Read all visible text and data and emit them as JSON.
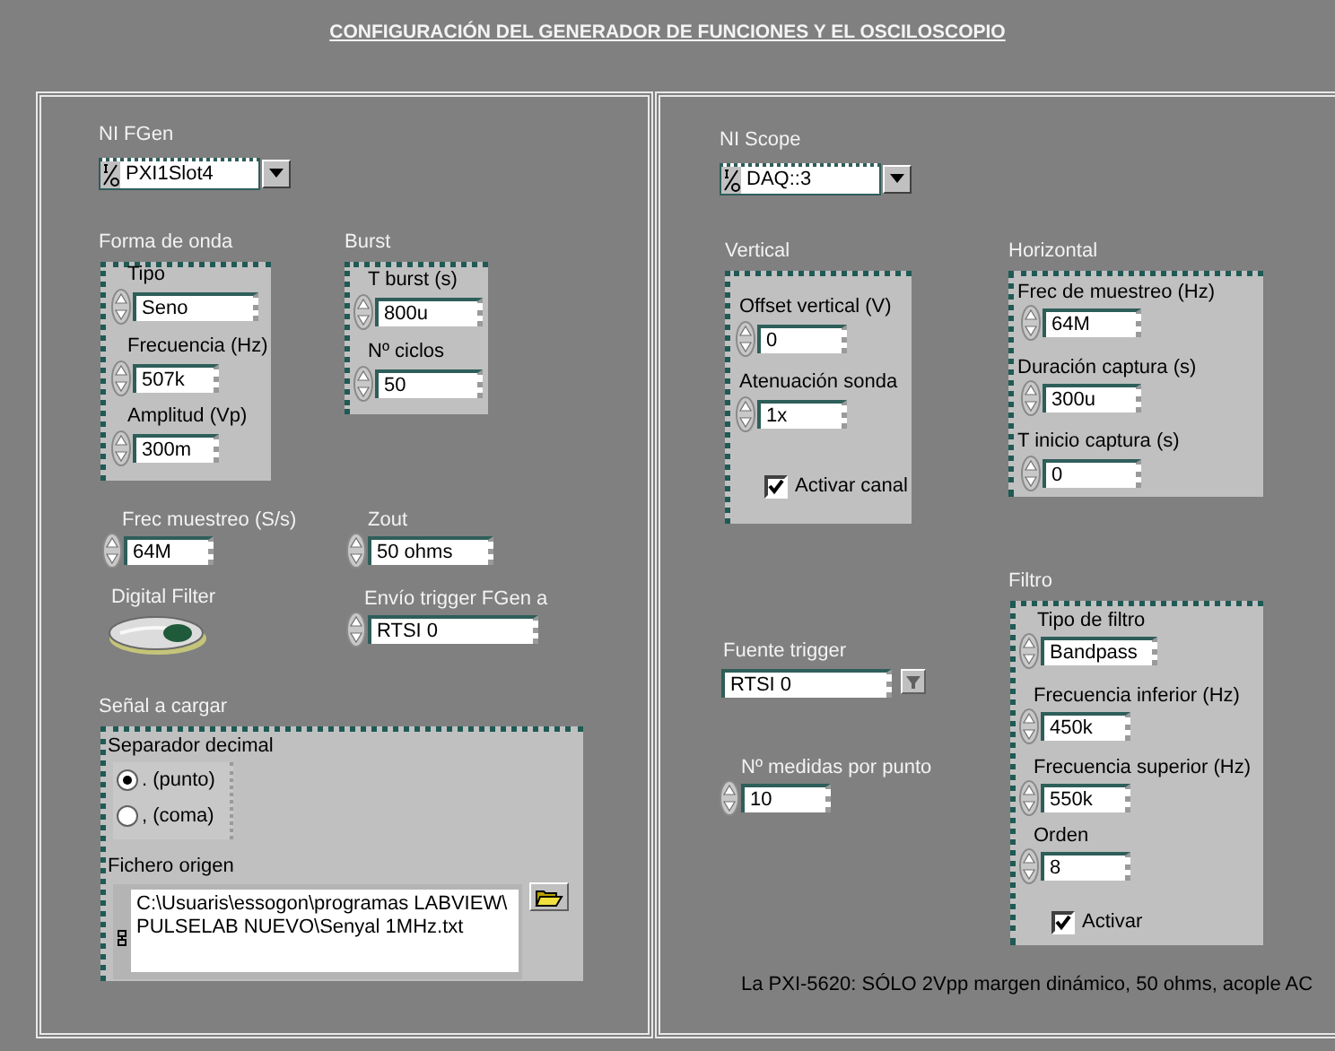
{
  "title": "CONFIGURACIÓN DEL GENERADOR DE FUNCIONES Y EL OSCILOSCOPIO",
  "fgen": {
    "resource": {
      "label": "NI FGen",
      "value": "PXI1Slot4"
    },
    "waveform": {
      "label": "Forma de onda",
      "fields": [
        {
          "label": "Tipo",
          "value": "Seno"
        },
        {
          "label": "Frecuencia (Hz)",
          "value": "507k"
        },
        {
          "label": "Amplitud (Vp)",
          "value": "300m"
        }
      ]
    },
    "burst": {
      "label": "Burst",
      "fields": [
        {
          "label": "T burst (s)",
          "value": "800u"
        },
        {
          "label": "Nº ciclos",
          "value": "50"
        }
      ]
    },
    "sample_rate": {
      "label": "Frec muestreo (S/s)",
      "value": "64M"
    },
    "zout": {
      "label": "Zout",
      "value": "50 ohms"
    },
    "digital_filter": {
      "label": "Digital Filter",
      "on": false
    },
    "trigger_out": {
      "label": "Envío trigger FGen a",
      "value": "RTSI 0"
    },
    "signal": {
      "label": "Señal a cargar",
      "separator": {
        "label": "Separador decimal",
        "options": [
          {
            "label": ". (punto)",
            "selected": true
          },
          {
            "label": ", (coma)",
            "selected": false
          }
        ]
      },
      "file": {
        "label": "Fichero origen",
        "lines": [
          "C:\\Usuaris\\essogon\\programas LABVIEW\\",
          "PULSELAB NUEVO\\Senyal 1MHz.txt"
        ]
      }
    }
  },
  "scope": {
    "resource": {
      "label": "NI Scope",
      "value": "DAQ::3"
    },
    "vertical": {
      "label": "Vertical",
      "fields": [
        {
          "label": "Offset vertical (V)",
          "value": "0"
        },
        {
          "label": "Atenuación sonda",
          "value": "1x"
        }
      ],
      "checkbox": {
        "label": "Activar canal",
        "checked": true
      }
    },
    "horizontal": {
      "label": "Horizontal",
      "fields": [
        {
          "label": "Frec de muestreo (Hz)",
          "value": "64M"
        },
        {
          "label": "Duración captura (s)",
          "value": "300u"
        },
        {
          "label": "T inicio captura (s)",
          "value": "0"
        }
      ]
    },
    "trigger_source": {
      "label": "Fuente trigger",
      "value": "RTSI 0"
    },
    "measurements": {
      "label": "Nº medidas por punto",
      "value": "10"
    },
    "filter": {
      "label": "Filtro",
      "fields": [
        {
          "label": "Tipo de filtro",
          "value": "Bandpass"
        },
        {
          "label": "Frecuencia inferior (Hz)",
          "value": "450k"
        },
        {
          "label": "Frecuencia superior (Hz)",
          "value": "550k"
        },
        {
          "label": "Orden",
          "value": "8"
        }
      ],
      "checkbox": {
        "label": "Activar",
        "checked": true
      }
    }
  },
  "note": "La PXI-5620: SÓLO 2Vpp margen dinámico, 50 ohms, acople AC"
}
